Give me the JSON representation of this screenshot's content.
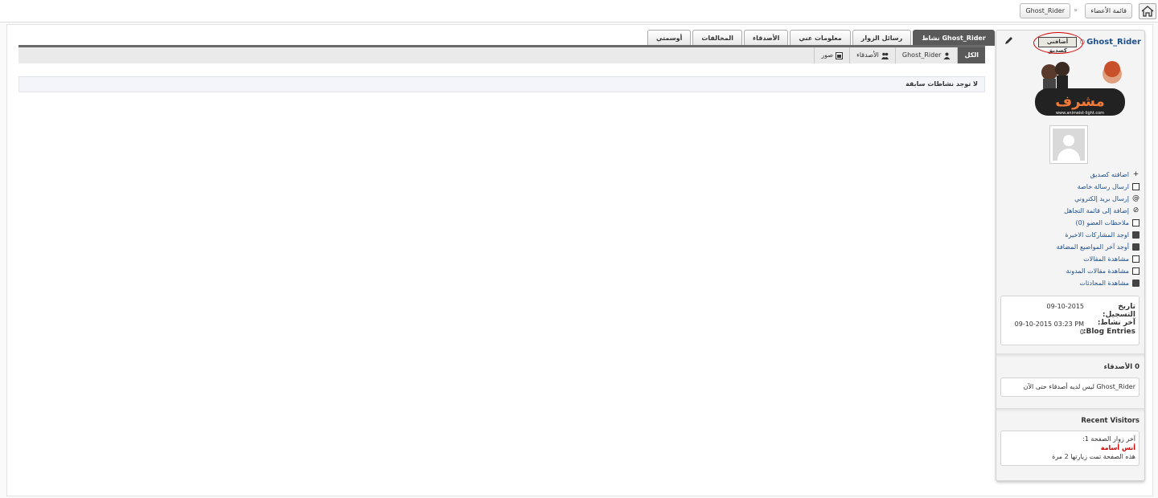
{
  "breadcrumb": {
    "members_list": "قائمة الأعضاء",
    "separator": "»",
    "current": "Ghost_Rider"
  },
  "profile": {
    "username": "Ghost_Rider",
    "friend_badge": "أضافني كصديق",
    "rank_text": "مشرف",
    "rank_url": "www.animeist-light.com",
    "actions": [
      {
        "icon": "plus-icon",
        "label": "اضافته كصديق"
      },
      {
        "icon": "mail-icon",
        "label": "ارسال رسالة خاصة"
      },
      {
        "icon": "at-icon",
        "label": "إرسال بريد إلكتروني"
      },
      {
        "icon": "block-icon",
        "label": "إضافة إلى قائمة التجاهل"
      },
      {
        "icon": "notes-icon",
        "label": "ملاحظات العضو (0)"
      },
      {
        "icon": "posts-icon",
        "label": "اوجد المشاركات الاخيرة"
      },
      {
        "icon": "threads-icon",
        "label": "أوجد آخر المواضيع المضافة"
      },
      {
        "icon": "articles-icon",
        "label": "مشاهدة المقالات"
      },
      {
        "icon": "blog-icon",
        "label": "مشاهدة مقالات المدونة"
      },
      {
        "icon": "conversations-icon",
        "label": "مشاهدة المحادثات"
      }
    ],
    "info": {
      "join_label_1": "تاريخ",
      "join_label_2": "التسجيل:",
      "join_date": "09-10-2015",
      "last_label": "آخر نشاط:",
      "last_activity": "09-10-2015 03:23 PM",
      "blog_label": "Blog Entries:",
      "blog_entries": "0"
    },
    "friends_title": "0 الأصدقاء",
    "friends_text": "Ghost_Rider ليس لديه أصدقاء حتى الآن",
    "visitors_title": "Recent Visitors",
    "visitors_line1": "آخر زوار الصفحة 1:",
    "visitors_name": "أنس أسامة",
    "visitors_line2": "هذه الصفحة تمت زيارتها 2 مرة"
  },
  "tabs": [
    {
      "label": "Ghost_Rider نشاط",
      "active": true
    },
    {
      "label": "رسائل الزوار",
      "active": false
    },
    {
      "label": "معلومات عني",
      "active": false
    },
    {
      "label": "الأصدقاء",
      "active": false
    },
    {
      "label": "المخالفات",
      "active": false
    },
    {
      "label": "أوسمتي",
      "active": false
    }
  ],
  "subtabs": [
    {
      "label": "الكل",
      "active": true
    },
    {
      "label": "Ghost_Rider",
      "active": false
    },
    {
      "label": "الأصدقاء",
      "active": false
    },
    {
      "label": "صور",
      "active": false
    }
  ],
  "no_activity": "لا توجد نشاطات سابقة"
}
